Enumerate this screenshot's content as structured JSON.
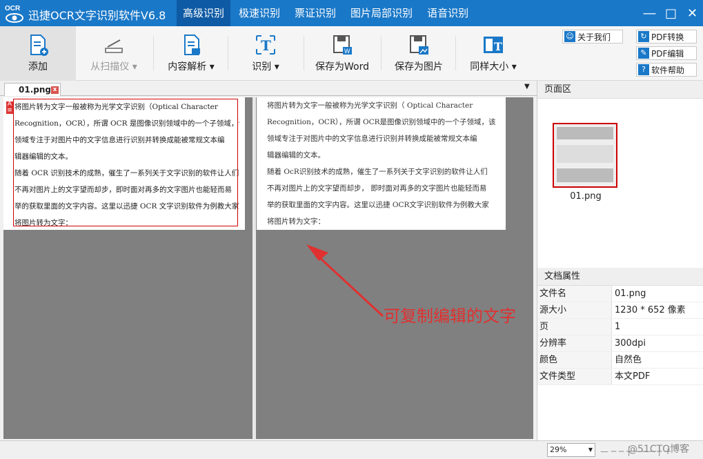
{
  "app": {
    "title": "迅捷OCR文字识别软件V6.8",
    "logo_text": "OCR"
  },
  "tabs": [
    {
      "label": "高级识别"
    },
    {
      "label": "极速识别"
    },
    {
      "label": "票证识别"
    },
    {
      "label": "图片局部识别"
    },
    {
      "label": "语音识别"
    }
  ],
  "toolbar": {
    "add": "添加",
    "scanner": "从扫描仪",
    "parse": "内容解析",
    "recognize": "识别",
    "save_word": "保存为Word",
    "save_image": "保存为图片",
    "same_size": "同样大小"
  },
  "side_buttons": {
    "about": "关于我们",
    "pdf_convert": "PDF转换",
    "pdf_edit": "PDF编辑",
    "help": "软件帮助"
  },
  "doc_tab": {
    "name": "01.png",
    "close": "x"
  },
  "left_lines": [
    "将图片转为文字一般被称为光学文字识别（Optical Character",
    "Recognition，OCR），所谓 OCR 是图像识别领域中的一个子领域，该",
    "领域专注于对图片中的文字信息进行识别并转换成能被常规文本编",
    "辑器编辑的文本。",
    "随着 OCR 识别技术的成熟，催生了一系列关于文字识别的软件让人们",
    "不再对图片上的文字望而却步，即时面对再多的文字图片也能轻而易",
    "举的获取里面的文字内容。这里以迅捷 OCR 文字识别软件为例教大家",
    "将图片转为文字："
  ],
  "right_lines": [
    "将图片转为文字一般被称为光学文字识别（ Optical Character",
    "Recognition，OCR），所谓 OCR是图像识别领域中的一个子领域，该",
    "领域专注于对图片中的文字信息进行识别并转换成能被常规文本编",
    "辑器编辑的文本。",
    "随着 OcR识别技术的成熟，催生了一系列关于文字识别的软件让人们",
    "不再对图片上的文字望而却步， 即时面对再多的文字图片也能轻而易",
    "举的获取里面的文字内容。这里以迅捷 OCR文字识别软件为例教大家",
    "将图片转为文字："
  ],
  "annotation": "可复制编辑的文字",
  "page_panel": {
    "title": "页面区",
    "thumb_label": "01.png"
  },
  "properties": {
    "title": "文档属性",
    "rows": [
      {
        "k": "文件名",
        "v": "01.png"
      },
      {
        "k": "源大小",
        "v": "1230 * 652 像素"
      },
      {
        "k": "页",
        "v": "1"
      },
      {
        "k": "分辨率",
        "v": "300dpi"
      },
      {
        "k": "颜色",
        "v": "自然色"
      },
      {
        "k": "文件类型",
        "v": "本文PDF"
      }
    ]
  },
  "status": {
    "zoom": "29%",
    "slider": "— ─ ─ ┼ ─ ─ ─ ┼ +",
    "watermark": "@51CTO博客"
  },
  "colors": {
    "brand": "#1a78c8",
    "active_tab": "#0e5aa4",
    "annotation": "#e03030"
  }
}
